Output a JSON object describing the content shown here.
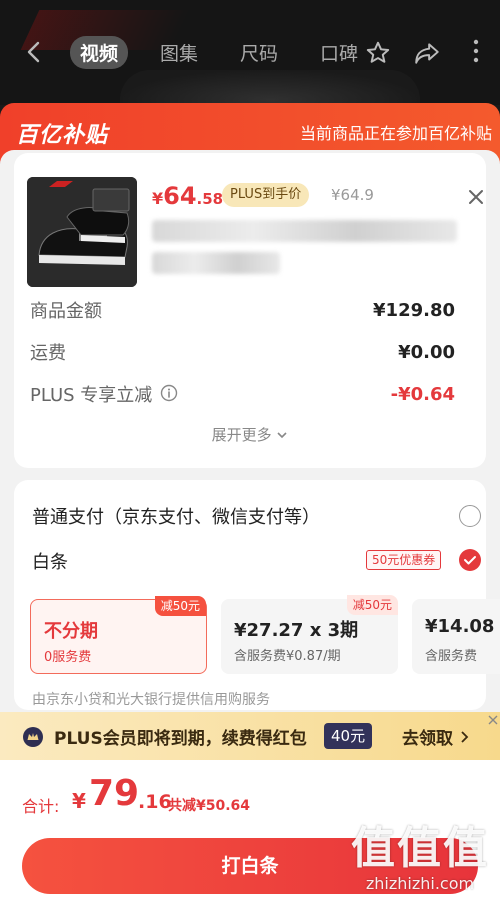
{
  "nav": {
    "tabs": [
      {
        "label": "视频",
        "active": true
      },
      {
        "label": "图集",
        "active": false
      },
      {
        "label": "尺码",
        "active": false
      },
      {
        "label": "口碑",
        "active": false
      }
    ]
  },
  "subsidy": {
    "logo": "百亿补贴",
    "note": "当前商品正在参加百亿补贴"
  },
  "product": {
    "price_symbol": "¥",
    "price_int": "64",
    "price_dec": ".58",
    "plus_badge": "PLUS到手价",
    "original_price": "¥64.9"
  },
  "details": {
    "rows": [
      {
        "label": "商品金额",
        "value": "¥129.80"
      },
      {
        "label": "运费",
        "value": "¥0.00"
      },
      {
        "label": "PLUS 专享立减",
        "value": "-¥0.64"
      }
    ],
    "expand": "展开更多"
  },
  "payment": {
    "options": [
      {
        "label": "普通支付（京东支付、微信支付等）",
        "checked": false
      },
      {
        "label": "白条",
        "checked": true
      }
    ],
    "coupon_tag": "50元优惠券",
    "plans": [
      {
        "title": "不分期",
        "sub": "0服务费",
        "badge": "减50元",
        "selected": true
      },
      {
        "title": "¥27.27 x 3期",
        "sub": "含服务费¥0.87/期",
        "badge": "减50元",
        "selected": false
      },
      {
        "title": "¥14.08",
        "sub": "含服务费",
        "badge": "",
        "selected": false
      }
    ],
    "lender": "由京东小贷和光大银行提供信用购服务"
  },
  "plus_strip": {
    "text": "PLUS会员即将到期，续费得红包",
    "amount": "40元",
    "cta": "去领取"
  },
  "footer": {
    "total_label": "合计:",
    "total_symbol": "¥",
    "total_int": "79",
    "total_dec": ".16",
    "discount": "共减¥50.64",
    "button": "打白条"
  },
  "watermark": {
    "chars": "值值值",
    "url": "zhizhizhi.com"
  },
  "colors": {
    "brand_red": "#e4393c",
    "plus_gold": "#f8e7b8",
    "plus_navy": "#32325a"
  }
}
